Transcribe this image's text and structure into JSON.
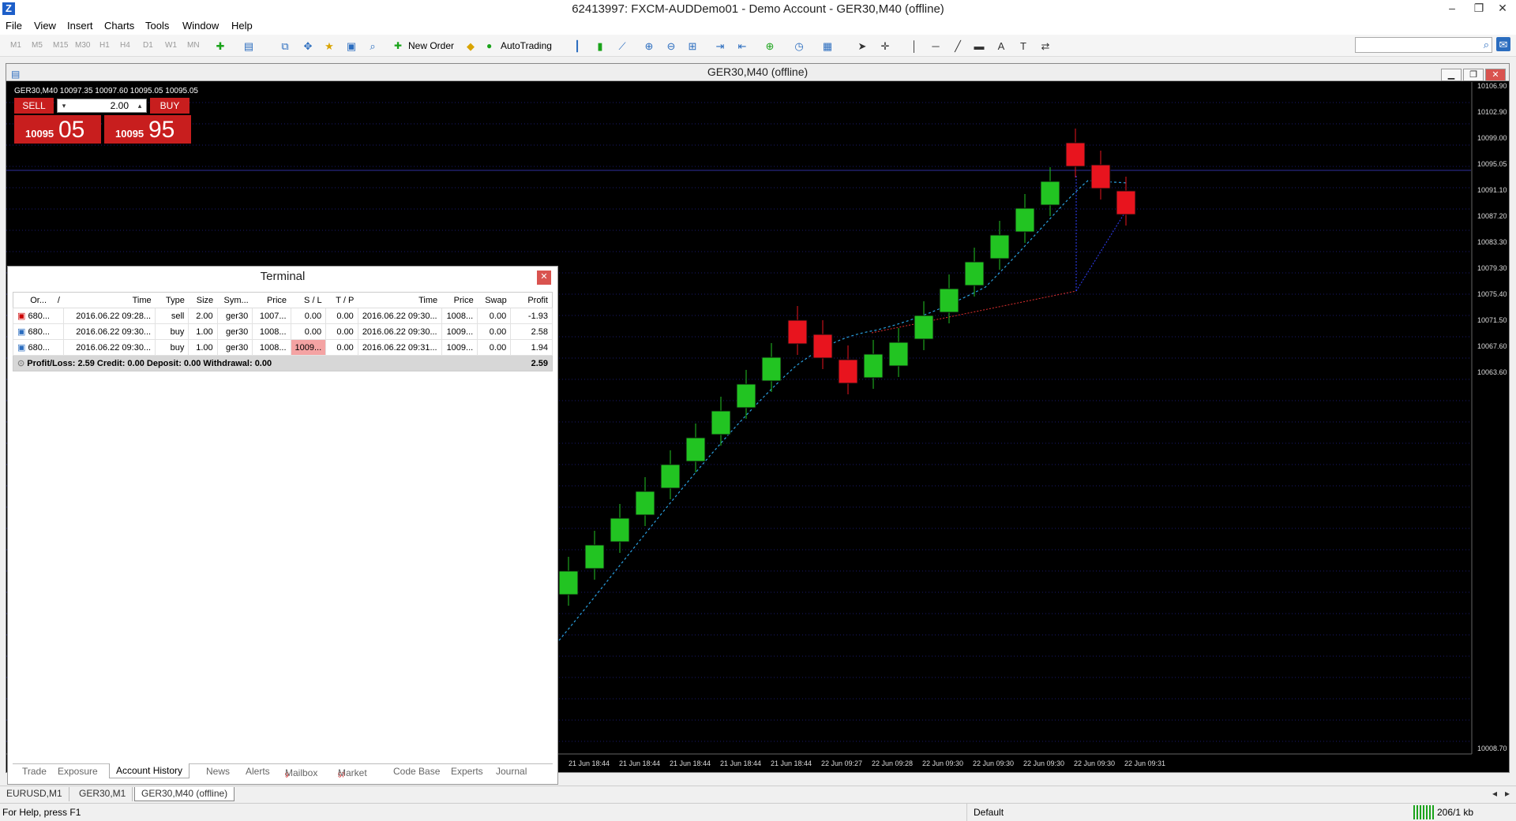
{
  "window": {
    "title": "62413997: FXCM-AUDDemo01 - Demo Account - GER30,M40 (offline)"
  },
  "menu": [
    "File",
    "View",
    "Insert",
    "Charts",
    "Tools",
    "Window",
    "Help"
  ],
  "toolbar": {
    "periods": [
      "M1",
      "M5",
      "M15",
      "M30",
      "H1",
      "H4",
      "D1",
      "W1",
      "MN"
    ],
    "new_order": "New Order",
    "autotrading": "AutoTrading"
  },
  "chart": {
    "window_title": "GER30,M40 (offline)",
    "symbol_header": "GER30,M40  10097.35 10097.60 10095.05 10095.05",
    "one_click": {
      "sell_label": "SELL",
      "buy_label": "BUY",
      "lot": "2.00",
      "sell_small": "10095",
      "sell_big": "05",
      "buy_small": "10095",
      "buy_big": "95"
    },
    "price_labels": [
      "10106.90",
      "10102.90",
      "10099.00",
      "10095.05",
      "10091.10",
      "10087.20",
      "10083.30",
      "10079.30",
      "10075.40",
      "10071.50",
      "10067.60",
      "10063.60",
      "10008.70"
    ],
    "time_labels": [
      "21 Jun 18:44",
      "21 Jun 18:44",
      "21 Jun 18:44",
      "21 Jun 18:44",
      "21 Jun 18:44",
      "22 Jun 09:27",
      "22 Jun 09:28",
      "22 Jun 09:30",
      "22 Jun 09:30",
      "22 Jun 09:30",
      "22 Jun 09:30",
      "22 Jun 09:31"
    ],
    "colors": {
      "bull": "#22c422",
      "bear": "#e8141e",
      "grid": "#1a1a6e",
      "background": "#000000"
    }
  },
  "terminal": {
    "title": "Terminal",
    "columns": [
      "Or...",
      "/",
      "Time",
      "Type",
      "Size",
      "Sym...",
      "Price",
      "S / L",
      "T / P",
      "Time",
      "Price",
      "Swap",
      "Profit"
    ],
    "rows": [
      [
        "680...",
        "2016.06.22 09:28...",
        "sell",
        "2.00",
        "ger30",
        "1007...",
        "0.00",
        "0.00",
        "2016.06.22 09:30...",
        "1008...",
        "0.00",
        "-1.93"
      ],
      [
        "680...",
        "2016.06.22 09:30...",
        "buy",
        "1.00",
        "ger30",
        "1008...",
        "0.00",
        "0.00",
        "2016.06.22 09:30...",
        "1009...",
        "0.00",
        "2.58"
      ],
      [
        "680...",
        "2016.06.22 09:30...",
        "buy",
        "1.00",
        "ger30",
        "1008...",
        "1009...",
        "0.00",
        "2016.06.22 09:31...",
        "1009...",
        "0.00",
        "1.94"
      ]
    ],
    "summary_text": "Profit/Loss: 2.59  Credit: 0.00  Deposit: 0.00  Withdrawal: 0.00",
    "summary_value": "2.59",
    "tabs": [
      "Trade",
      "Exposure",
      "Account History",
      "News",
      "Alerts",
      "Mailbox",
      "Market",
      "Code Base",
      "Experts",
      "Journal"
    ],
    "mailbox_count": "9",
    "market_count": "57",
    "active_tab": "Account History"
  },
  "chart_tabs": [
    "EURUSD,M1",
    "GER30,M1",
    "GER30,M40 (offline)"
  ],
  "status": {
    "help": "For Help, press F1",
    "profile": "Default",
    "traffic": "206/1 kb"
  }
}
